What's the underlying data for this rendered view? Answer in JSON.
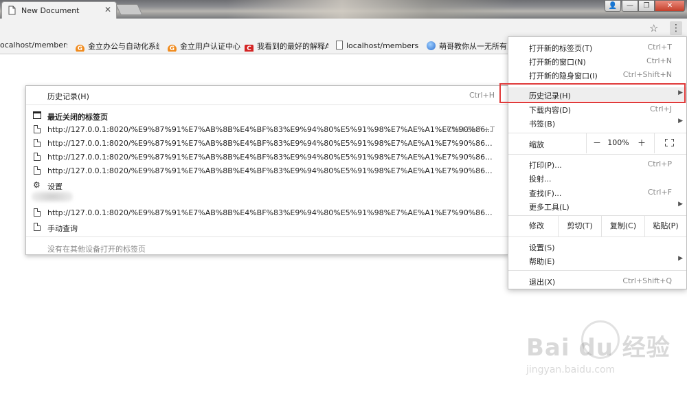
{
  "browser": {
    "tab": {
      "title": "New Document",
      "close": "✕"
    },
    "window_buttons": {
      "user": "👤",
      "minimize": "—",
      "maximize": "❐",
      "close": "✕"
    },
    "toolbar": {
      "star": "☆",
      "menu": "⋮"
    }
  },
  "bookmarks": [
    {
      "label": "ocalhost/members/",
      "icon": "doc"
    },
    {
      "label": "金立办公与自动化系统",
      "icon": "orange-circle"
    },
    {
      "label": "金立用户认证中心",
      "icon": "orange-circle"
    },
    {
      "label": "我看到的最好的解释A",
      "icon": "red-c"
    },
    {
      "label": "localhost/members/",
      "icon": "doc"
    },
    {
      "label": "萌哥教你从一无所有到",
      "icon": "globe"
    }
  ],
  "history_menu": {
    "header": {
      "label": "历史记录(H)",
      "shortcut": "Ctrl+H"
    },
    "recent_title": "最近关闭的标签页",
    "items": [
      {
        "label": "http://127.0.0.1:8020/%E9%87%91%E7%AB%8B%E4%BF%83%E9%94%80%E5%91%98%E7%AE%A1%E7%90%86...",
        "shortcut": "Ctrl+Shift+T",
        "icon": "file"
      },
      {
        "label": "http://127.0.0.1:8020/%E9%87%91%E7%AB%8B%E4%BF%83%E9%94%80%E5%91%98%E7%AE%A1%E7%90%86...",
        "shortcut": "",
        "icon": "file"
      },
      {
        "label": "http://127.0.0.1:8020/%E9%87%91%E7%AB%8B%E4%BF%83%E9%94%80%E5%91%98%E7%AE%A1%E7%90%86...",
        "shortcut": "",
        "icon": "file"
      },
      {
        "label": "http://127.0.0.1:8020/%E9%87%91%E7%AB%8B%E4%BF%83%E9%94%80%E5%91%98%E7%AE%A1%E7%90%86...",
        "shortcut": "",
        "icon": "file"
      },
      {
        "label": "设置",
        "shortcut": "",
        "icon": "gear"
      },
      {
        "label": "http://127.0.0.1:8020/%E9%87%91%E7%AB%8B%E4%BF%83%E9%94%80%E5%91%98%E7%AE%A1%E7%90%86...",
        "shortcut": "",
        "icon": "file"
      },
      {
        "label": "手动查询",
        "shortcut": "",
        "icon": "file"
      }
    ],
    "footer": "没有在其他设备打开的标签页"
  },
  "main_menu": {
    "new_tab": {
      "label": "打开新的标签页(T)",
      "shortcut": "Ctrl+T"
    },
    "new_window": {
      "label": "打开新的窗口(N)",
      "shortcut": "Ctrl+N"
    },
    "incognito": {
      "label": "打开新的隐身窗口(I)",
      "shortcut": "Ctrl+Shift+N"
    },
    "history": {
      "label": "历史记录(H)"
    },
    "downloads": {
      "label": "下载内容(D)",
      "shortcut": "Ctrl+J"
    },
    "bookmarks": {
      "label": "书签(B)"
    },
    "zoom": {
      "label": "缩放",
      "minus": "－",
      "value": "100%",
      "plus": "＋"
    },
    "print": {
      "label": "打印(P)...",
      "shortcut": "Ctrl+P"
    },
    "cast": {
      "label": "投射..."
    },
    "find": {
      "label": "查找(F)...",
      "shortcut": "Ctrl+F"
    },
    "more_tools": {
      "label": "更多工具(L)"
    },
    "edit": {
      "label": "修改",
      "cut": "剪切(T)",
      "copy": "复制(C)",
      "paste": "粘贴(P)"
    },
    "settings": {
      "label": "设置(S)"
    },
    "help": {
      "label": "帮助(E)"
    },
    "exit": {
      "label": "退出(X)",
      "shortcut": "Ctrl+Shift+Q"
    },
    "arrow": "▶"
  },
  "watermark": {
    "brand": "Bai du 经验",
    "url": "jingyan.baidu.com"
  },
  "colors": {
    "highlight_border": "#e03a3a",
    "toolbar_bg": "#f2f2f2"
  }
}
